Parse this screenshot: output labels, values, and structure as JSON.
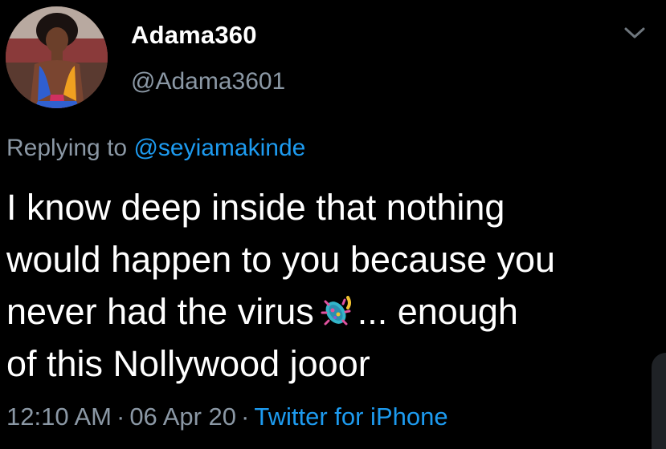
{
  "tweet": {
    "display_name": "Adama360",
    "handle": "@Adama3601",
    "replying_prefix": "Replying to",
    "replying_to": "@seyiamakinde",
    "text_lines": [
      "I know deep inside that nothing",
      "would happen to you because you",
      "never had the virus",
      "... enough",
      "of this Nollywood jooor"
    ],
    "time": "12:10 AM",
    "separator": "·",
    "date": "06 Apr 20",
    "source": "Twitter for iPhone"
  },
  "icons": {
    "menu": "chevron-down-icon",
    "emoji": "microbe-emoji-icon"
  },
  "colors": {
    "background": "#000000",
    "text": "#ffffff",
    "secondary_text": "#8b98a5",
    "link": "#1d9bf0"
  }
}
